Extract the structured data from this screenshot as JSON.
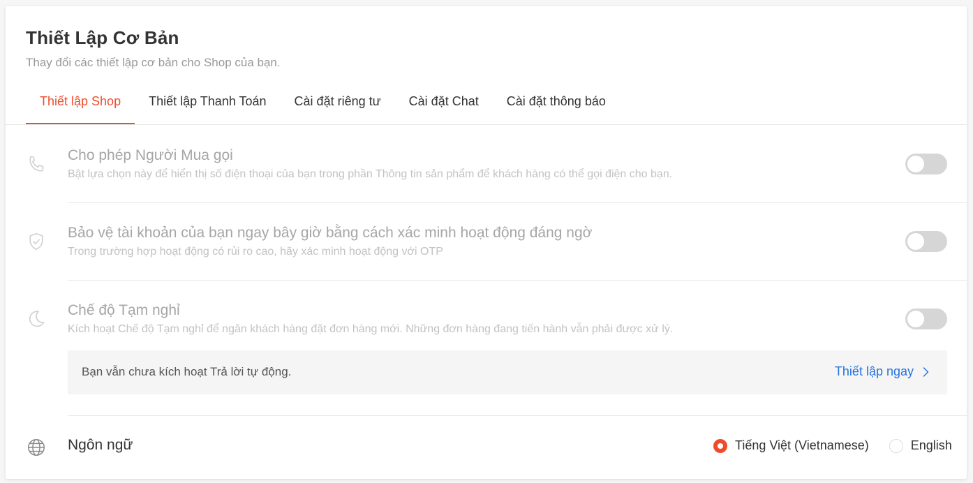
{
  "header": {
    "title": "Thiết Lập Cơ Bản",
    "subtitle": "Thay đổi các thiết lập cơ bản cho Shop của bạn."
  },
  "tabs": [
    {
      "label": "Thiết lập Shop",
      "active": true
    },
    {
      "label": "Thiết lập Thanh Toán",
      "active": false
    },
    {
      "label": "Cài đặt riêng tư",
      "active": false
    },
    {
      "label": "Cài đặt Chat",
      "active": false
    },
    {
      "label": "Cài đặt thông báo",
      "active": false
    }
  ],
  "settings": [
    {
      "icon": "phone-icon",
      "title": "Cho phép Người Mua gọi",
      "description": "Bật lựa chọn này để hiển thị số điện thoại của bạn trong phần Thông tin sản phẩm để khách hàng có thể gọi điện cho bạn.",
      "enabled": false
    },
    {
      "icon": "shield-check-icon",
      "title": "Bảo vệ tài khoản của bạn ngay bây giờ bằng cách xác minh hoạt động đáng ngờ",
      "description": "Trong trường hợp hoạt động có rủi ro cao, hãy xác minh hoạt động với OTP",
      "enabled": false
    },
    {
      "icon": "moon-icon",
      "title": "Chế độ Tạm nghỉ",
      "description": "Kích hoạt Chế độ Tạm nghỉ để ngăn khách hàng đặt đơn hàng mới. Những đơn hàng đang tiến hành vẫn phải được xử lý.",
      "enabled": false
    }
  ],
  "notice": {
    "text": "Bạn vẫn chưa kích hoạt Trả lời tự động.",
    "link_label": "Thiết lập ngay",
    "link_icon": "chevron-right-icon"
  },
  "language": {
    "icon": "globe-icon",
    "title": "Ngôn ngữ",
    "options": [
      {
        "label": "Tiếng Việt (Vietnamese)",
        "selected": true
      },
      {
        "label": "English",
        "selected": false
      }
    ]
  },
  "colors": {
    "accent": "#ee4d2d",
    "link": "#2673dd",
    "toggle_off": "#d6d6d6"
  }
}
